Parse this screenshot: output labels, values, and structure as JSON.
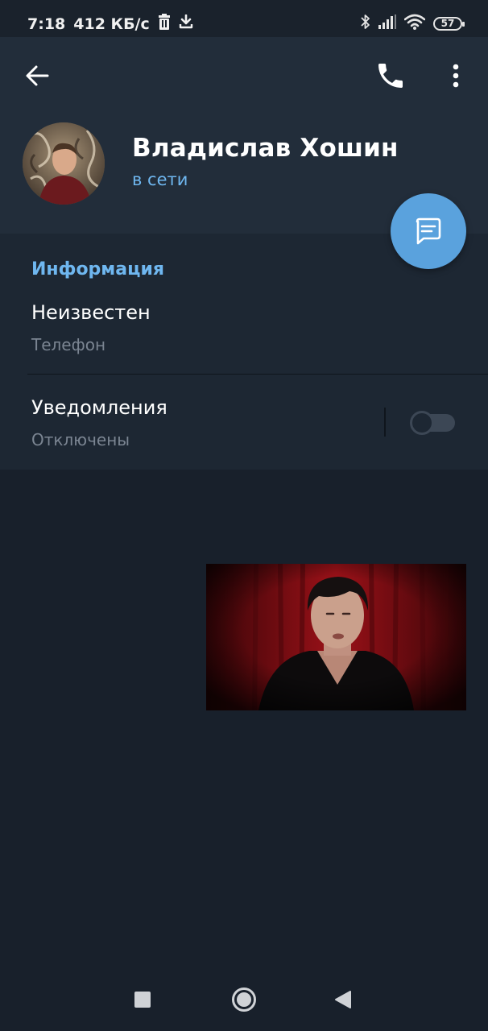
{
  "status_bar": {
    "time": "7:18",
    "network_speed": "412 КБ/с",
    "battery_level": "57",
    "icons": [
      "trash-icon",
      "download-icon",
      "bluetooth-icon",
      "signal-icon",
      "wifi-icon",
      "battery-icon"
    ]
  },
  "header": {
    "icons": [
      "back-arrow-icon",
      "phone-icon",
      "more-vertical-icon"
    ],
    "profile": {
      "name": "Владислав Хошин",
      "status": "в сети"
    },
    "fab_icon": "message-icon"
  },
  "info": {
    "section_title": "Информация",
    "phone": {
      "value": "Неизвестен",
      "label": "Телефон"
    },
    "notifications": {
      "title": "Уведомления",
      "value": "Отключены",
      "toggle_on": false
    }
  },
  "navigation": {
    "icons": [
      "recents-square-icon",
      "home-circle-icon",
      "back-triangle-icon"
    ]
  },
  "colors": {
    "header_bg": "#222d3a",
    "card_bg": "#1d2733",
    "screen_bg": "#18202b",
    "accent": "#6fb7f0",
    "fab": "#5aa2dd"
  }
}
